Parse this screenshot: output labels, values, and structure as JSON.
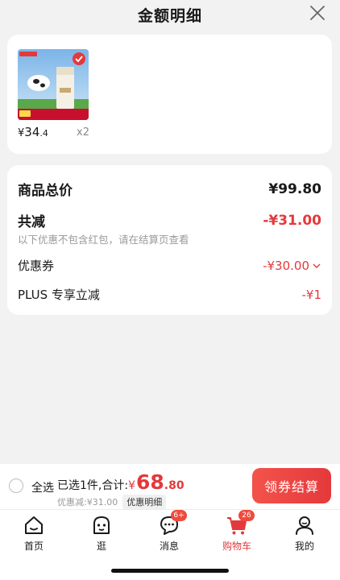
{
  "header": {
    "title": "金额明细",
    "close_icon": "close-icon"
  },
  "product": {
    "image": "jd-milk-product-image",
    "price_symbol": "¥",
    "price_int": "34",
    "price_dec": ".4",
    "quantity": "x2"
  },
  "detail": {
    "total_label": "商品总价",
    "total_value": "¥99.80",
    "reduce_label": "共减",
    "reduce_value": "-¥31.00",
    "note": "以下优惠不包含红包，请在结算页查看",
    "coupon_label": "优惠券",
    "coupon_value": "-¥30.00",
    "plus_label": "PLUS 专享立减",
    "plus_value": "-¥1"
  },
  "checkout": {
    "select_all": "全选",
    "selected_text": "已选1件,合计:",
    "total_symbol": "¥",
    "total_int": "68",
    "total_dec": ".80",
    "discount_text": "优惠减:¥31.00",
    "detail_tag": "优惠明细",
    "pay_button": "领券结算"
  },
  "tabs": [
    {
      "label": "首页",
      "icon": "home-icon",
      "badge": ""
    },
    {
      "label": "逛",
      "icon": "browse-icon",
      "badge": ""
    },
    {
      "label": "消息",
      "icon": "message-icon",
      "badge": "6+"
    },
    {
      "label": "购物车",
      "icon": "cart-icon",
      "badge": "26"
    },
    {
      "label": "我的",
      "icon": "profile-icon",
      "badge": ""
    }
  ],
  "colors": {
    "accent": "#e4393c",
    "button_gradient_start": "#f3534a",
    "button_gradient_end": "#e4393c"
  }
}
